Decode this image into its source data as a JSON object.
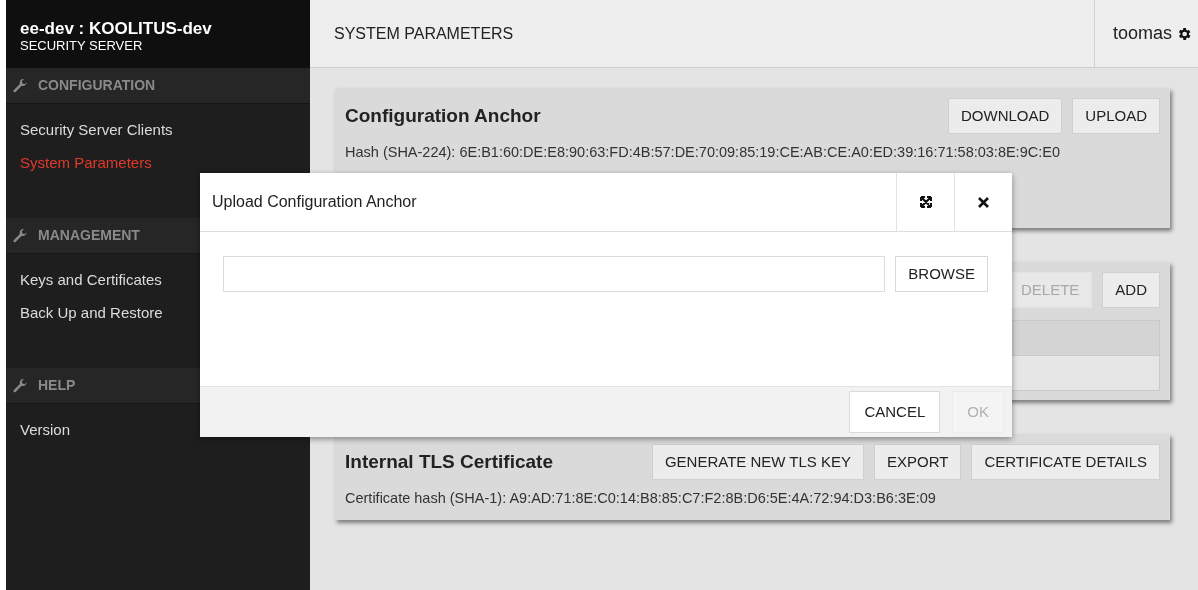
{
  "sidebar": {
    "title": "ee-dev : KOOLITUS-dev",
    "subtitle": "SECURITY SERVER",
    "sections": [
      {
        "heading": "CONFIGURATION",
        "items": [
          {
            "label": "Security Server Clients",
            "selected": false
          },
          {
            "label": "System Parameters",
            "selected": true
          }
        ]
      },
      {
        "heading": "MANAGEMENT",
        "items": [
          {
            "label": "Keys and Certificates",
            "selected": false
          },
          {
            "label": "Back Up and Restore",
            "selected": false
          }
        ]
      },
      {
        "heading": "HELP",
        "items": [
          {
            "label": "Version",
            "selected": false
          }
        ]
      }
    ]
  },
  "header": {
    "title": "SYSTEM PARAMETERS",
    "user": "toomas"
  },
  "cards": [
    {
      "title": "Configuration Anchor",
      "buttons": [
        {
          "label": "DOWNLOAD",
          "disabled": false
        },
        {
          "label": "UPLOAD",
          "disabled": false
        }
      ],
      "text": "Hash (SHA-224): 6E:B1:60:DE:E8:90:63:FD:4B:57:DE:70:09:85:19:CE:AB:CE:A0:ED:39:16:71:58:03:8E:9C:E0"
    },
    {
      "buttons": [
        {
          "label": "DELETE",
          "disabled": true
        },
        {
          "label": "ADD",
          "disabled": false
        }
      ],
      "table": true
    },
    {
      "title": "Internal TLS Certificate",
      "buttons": [
        {
          "label": "GENERATE NEW TLS KEY",
          "disabled": false
        },
        {
          "label": "EXPORT",
          "disabled": false
        },
        {
          "label": "CERTIFICATE DETAILS",
          "disabled": false
        }
      ],
      "text": "Certificate hash (SHA-1): A9:AD:71:8E:C0:14:B8:85:C7:F2:8B:D6:5E:4A:72:94:D3:B6:3E:09"
    }
  ],
  "dialog": {
    "title": "Upload Configuration Anchor",
    "browse": "BROWSE",
    "buttons": [
      {
        "label": "CANCEL",
        "disabled": false
      },
      {
        "label": "OK",
        "disabled": true
      }
    ]
  }
}
